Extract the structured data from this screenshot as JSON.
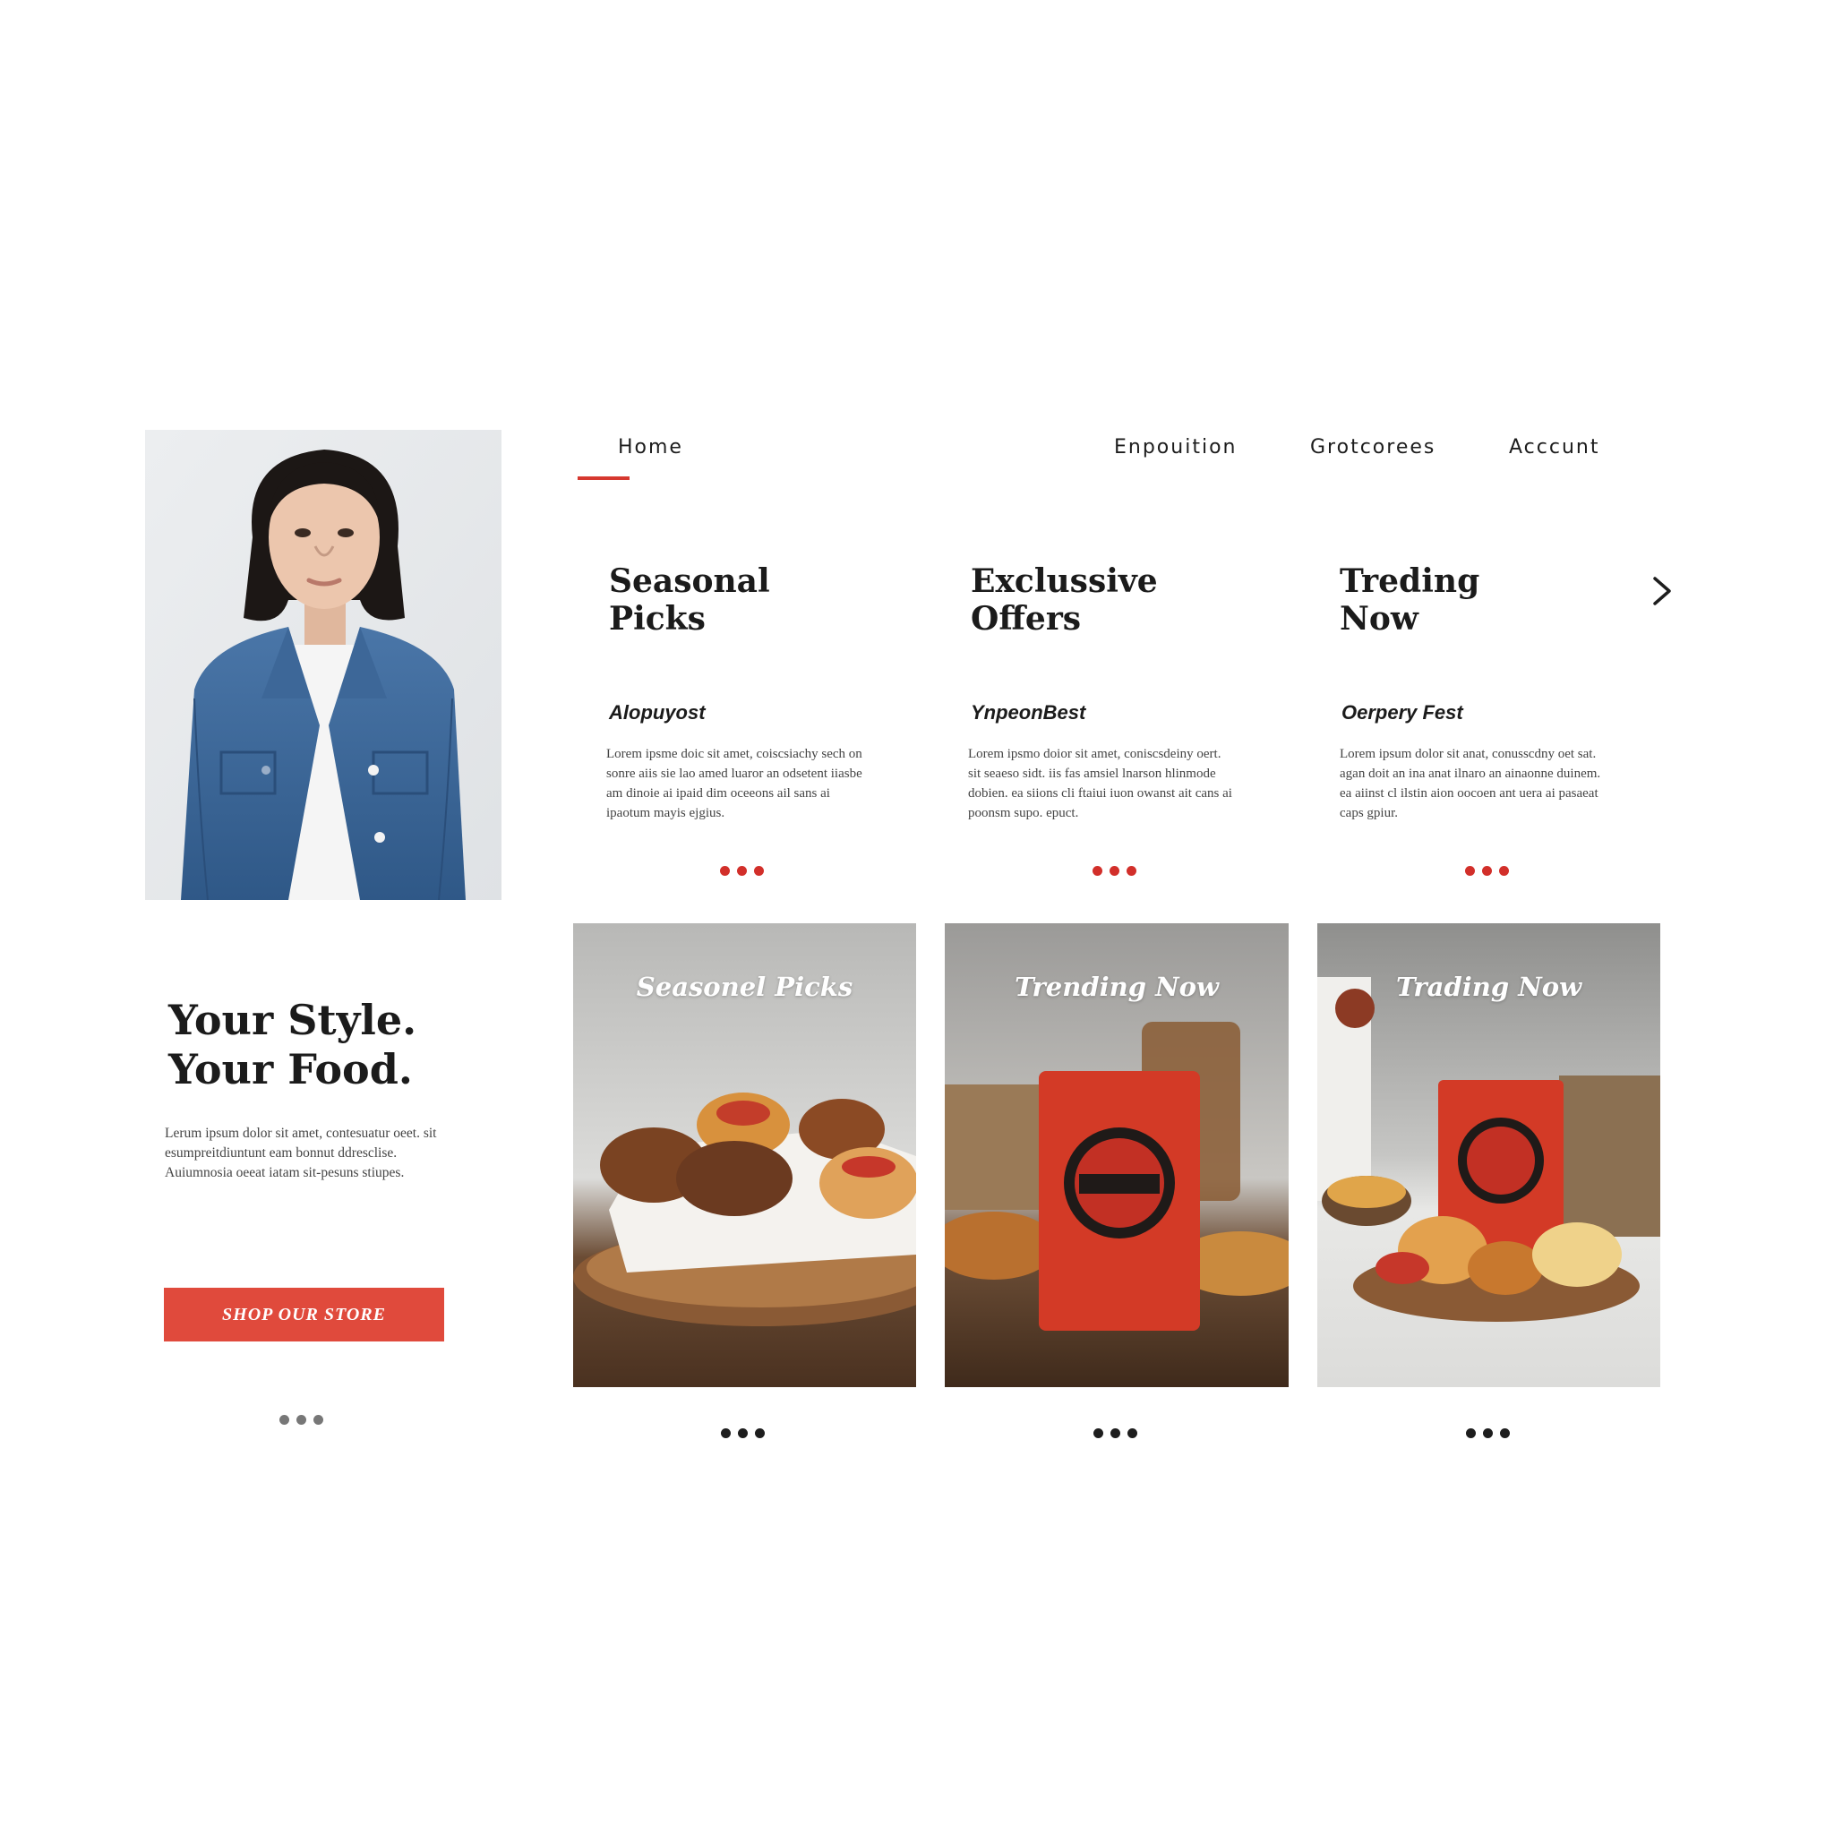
{
  "nav": {
    "items": [
      "Home",
      "Enpouition",
      "Grotcorees",
      "Acccunt"
    ],
    "active": "Home"
  },
  "features": [
    {
      "title": "Seasonal\nPicks",
      "subtitle": "Alopuyost",
      "body": "Lorem ipsme doic sit amet, coiscsiachy sech on sonre aiis sie lao amed luaror an odsetent iiasbe am dinoie ai ipaid dim oceeons ail sans ai ipaotum mayis ejgius."
    },
    {
      "title": "Exclussive\nOffers",
      "subtitle": "YnpeonBest",
      "body": "Lorem ipsmo doior sit amet, coniscsdeiny oert. sit seaeso sidt. iis fas amsiel lnarson hlinmode dobien. ea siions cli ftaiui iuon owanst ait cans ai poonsm supo. epuct."
    },
    {
      "title": "Treding\nNow",
      "subtitle": "Oerpery Fest",
      "body": "Lorem ipsum dolor sit anat, conusscdny oet sat. agan doit an ina anat ilnaro an ainaonne duinem. ea aiinst cl ilstin aion oocoen ant uera ai pasaeat caps gpiur."
    }
  ],
  "hero": {
    "title": "Your Style.\nYour Food.",
    "body": "Lerum ipsum dolor sit amet, contesuatur oeet. sit esumpreitdiuntunt eam bonnut ddresclise. Auiumnosia oeeat iatam sit-pesuns stiupes.",
    "cta": "SHOP OUR STORE"
  },
  "cards": [
    {
      "label": "Seasonel Picks"
    },
    {
      "label": "Trending Now"
    },
    {
      "label": "Trading Now"
    }
  ],
  "colors": {
    "accent": "#d22f2a",
    "button": "#e04a3c",
    "text": "#1b1b1b"
  },
  "icons": {
    "next": "chevron-right-icon"
  }
}
